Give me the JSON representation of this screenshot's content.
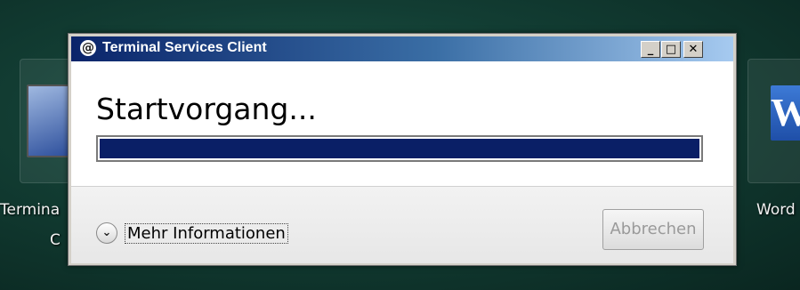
{
  "desktop": {
    "left_icon_label_line1": "Termina",
    "left_icon_label_line2": "C",
    "right_icon_label": "Word",
    "right_icon_glyph": "W"
  },
  "window": {
    "title": "Terminal Services Client",
    "title_icon_glyph": "@",
    "controls": {
      "minimize": "_",
      "maximize": "□",
      "close": "✕"
    }
  },
  "main": {
    "status_text": "Startvorgang...",
    "progress_fraction": 1.0
  },
  "footer": {
    "more_info_label": "Mehr Informationen",
    "cancel_label": "Abbrechen",
    "chevron_glyph": "⌄"
  },
  "colors": {
    "progress_fill": "#0a1f66",
    "titlebar_start": "#0a246a",
    "titlebar_end": "#a6caf0"
  }
}
